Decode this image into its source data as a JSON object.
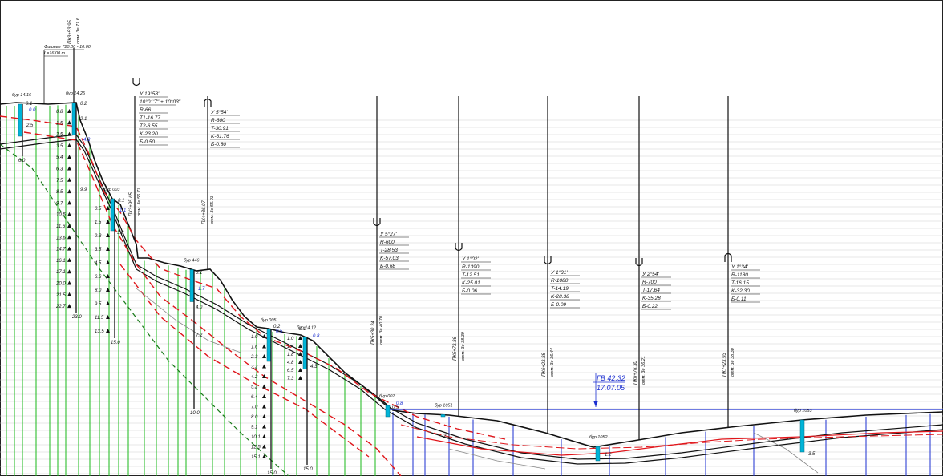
{
  "colors": {
    "ground": "#111111",
    "road": "#111111",
    "water": "#1b2fd0",
    "layer": "#e0161b",
    "green": "#19b819",
    "wells": "#00b4d8",
    "grid": "#b9b9b9"
  },
  "water_level": {
    "label": "ГВ 42.32",
    "date": "17.07.05"
  },
  "pickets": [
    {
      "label": "ПК3+53.95",
      "sub": "отм. 3е  71.6"
    },
    {
      "label": "ПК3+95.65",
      "sub": "отм. 3е  56.77"
    },
    {
      "label": "ПК4+36.07",
      "sub": "отм. 3е  55.03"
    },
    {
      "label": "ПК5+30.24",
      "sub": "отм. 3е  40.70"
    },
    {
      "label": "ПК5+73.86",
      "sub": "отм. 3е  38.39"
    },
    {
      "label": "ПК6+23.88",
      "sub": "отм. 3е  36.44"
    },
    {
      "label": "ПК6+76.30",
      "sub": "отм. 3е  36.21"
    },
    {
      "label": "ПК7+23.93",
      "sub": "отм. 3е  38.30"
    }
  ],
  "curves": [
    {
      "symbol": "U",
      "lines": [
        "У 19°58'",
        "10°01'7\" + 10°03\"",
        "R-66",
        "T1-16.77",
        "T2-6.55",
        "K-23.20",
        "Б-0.50"
      ]
    },
    {
      "symbol": "∩",
      "lines": [
        "У 5°54'",
        "R-600",
        "T-30.91",
        "K-61.76",
        "Б-0.80"
      ]
    },
    {
      "symbol": "U",
      "lines": [
        "У 5°27'",
        "R-600",
        "T-28.53",
        "K-57.03",
        "Б-0.68"
      ]
    },
    {
      "symbol": "U",
      "lines": [
        "У 1°02'",
        "R-1390",
        "T-12.51",
        "K-25.01",
        "Б-0.06"
      ]
    },
    {
      "symbol": "U",
      "lines": [
        "У 1°31'",
        "R-1080",
        "T-14.19",
        "K-28.38",
        "Б-0.09"
      ]
    },
    {
      "symbol": "U",
      "lines": [
        "У 2°54'",
        "R-700",
        "T-17.64",
        "K-35.28",
        "Б-0.22"
      ]
    },
    {
      "symbol": "∩",
      "lines": [
        "У 1°34'",
        "R-1180",
        "T-16.15",
        "K-32.30",
        "Б-0.11"
      ]
    }
  ],
  "top_note": {
    "line1": "Фишеве 720.00 - 10.00",
    "line2": "L=16.00 m"
  },
  "boreholes": [
    {
      "label": "бур 14.16",
      "depth": "6.0"
    },
    {
      "label": "бур 14.25",
      "depth": "23.0"
    },
    {
      "label": "бур 003",
      "depth": "15.0"
    },
    {
      "label": "бур 446",
      "depth": "10.0"
    },
    {
      "label": "бур 005",
      "depth": "15.0"
    },
    {
      "label": "бур 14.12",
      "depth": "15.0"
    },
    {
      "label": "бур 007"
    },
    {
      "label": "бур 1051"
    },
    {
      "label": "бур 1052"
    },
    {
      "label": "бур 1053"
    }
  ],
  "depth_marks": {
    "bh2": [
      "0.8",
      "1.5",
      "2.5",
      "3.5",
      "5.4",
      "6.3",
      "7.5",
      "8.5",
      "9.7",
      "10.5",
      "11.6",
      "13.6",
      "14.7",
      "16.1",
      "17.1",
      "20.0",
      "21.5",
      "22.7"
    ],
    "bh3": [
      "0.5",
      "1.5",
      "2.3",
      "3.5",
      "4.5",
      "6.6",
      "8.0",
      "9.5",
      "11.5",
      "13.5"
    ],
    "bh5": [
      "1.0",
      "1.6",
      "2.3",
      "3.2",
      "4.2",
      "5.2",
      "6.4",
      "7.0",
      "8.0",
      "9.1",
      "10.1",
      "12.5",
      "15.1"
    ],
    "bh6": [
      "1.0",
      "1.4",
      "1.8",
      "4.8",
      "6.5",
      "7.3"
    ]
  },
  "misc_labels": {
    "bh1_top": "0.1",
    "bh1_mid": "2.5",
    "bh1_water": "0.0",
    "bh2_top": "0.2",
    "bh2_b": "2.1",
    "bh2_c": "9.9",
    "bh2_water": "4.3",
    "bh3_top": "0.1",
    "bh3_water": "1.1",
    "bh3_b": "3.8",
    "bh4_top": "0.1",
    "bh4_water": "1.7",
    "bh4_b": "4.0",
    "bh4_c": "7.2",
    "bh5_top": "0.2",
    "bh5_water": "0.5",
    "bh6_top": "0.1",
    "bh6_water": "0.8",
    "bh6_b": "4.3",
    "bh7_water": "0.8",
    "bh7_b": "0.5",
    "road_a": "2.1",
    "road_b": "1.2",
    "right_a": "3.5"
  }
}
